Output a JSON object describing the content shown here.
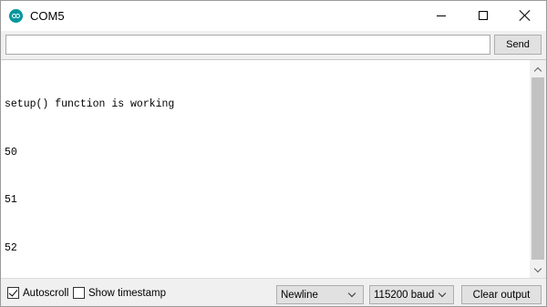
{
  "window": {
    "title": "COM5",
    "icon": "arduino-icon"
  },
  "input": {
    "value": "",
    "send_label": "Send"
  },
  "output": {
    "lines": [
      "setup() function is working",
      "50",
      "51",
      "52"
    ]
  },
  "footer": {
    "autoscroll_label": "Autoscroll",
    "autoscroll_checked": true,
    "timestamp_label": "Show timestamp",
    "timestamp_checked": false,
    "line_ending": "Newline",
    "baud_rate": "115200 baud",
    "clear_label": "Clear output"
  },
  "colors": {
    "accent": "#00979d"
  }
}
